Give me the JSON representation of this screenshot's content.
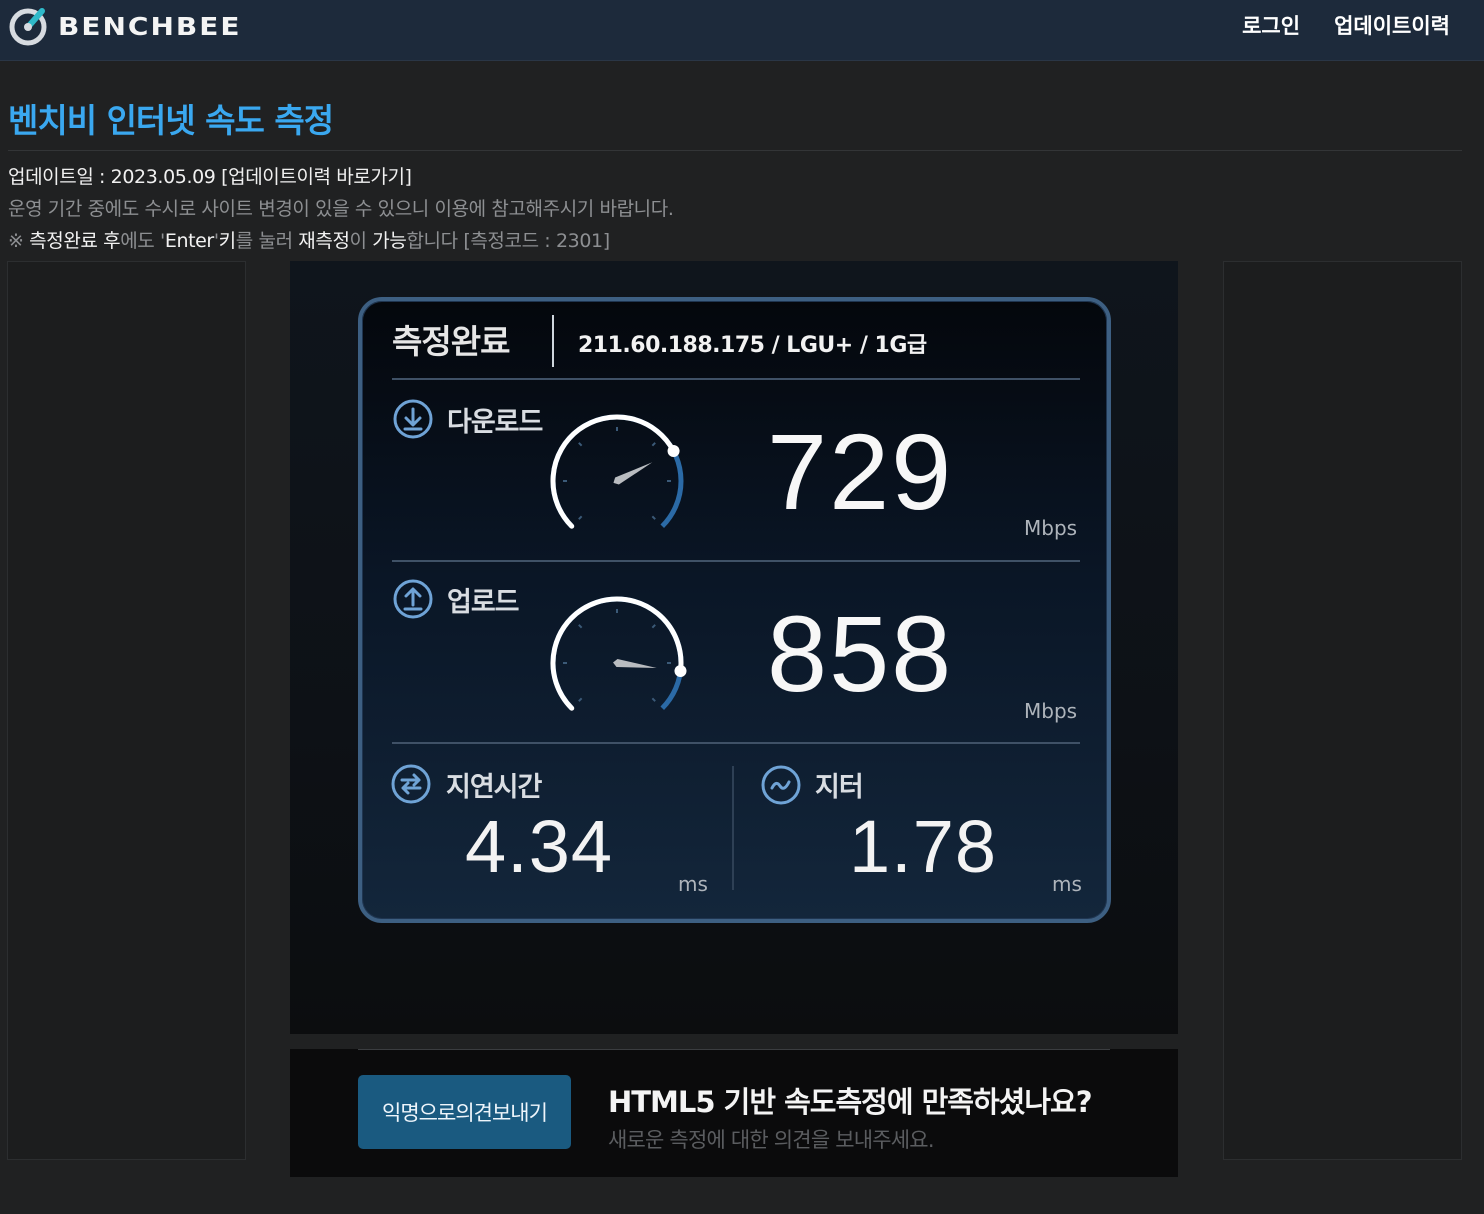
{
  "header": {
    "logo_text": "BENCHBEE",
    "nav": [
      "로그인",
      "업데이트이력"
    ]
  },
  "page": {
    "title": "벤치비 인터넷 속도 측정",
    "update_line_prefix": "업데이트일 : 2023.05.09 ",
    "update_link": "[업데이트이력 바로가기]",
    "notice": "운영 기간 중에도 수시로 사이트 변경이 있을 수 있으니 이용에 참고해주시기 바랍니다.",
    "tip": {
      "p1": "※ ",
      "p2": "측정완료 후",
      "p3": "에도 '",
      "p4": "Enter",
      "p5": "'",
      "p6": "키",
      "p7": "를 눌러 ",
      "p8": "재측정",
      "p9": "이 ",
      "p10": "가능",
      "p11": "합니다 [측정코드 : 2301]"
    }
  },
  "result": {
    "status": "측정완료",
    "connection": "211.60.188.175 / LGU+ / 1G급",
    "download": {
      "label": "다운로드",
      "value": "729",
      "unit": "Mbps",
      "gauge_fraction": 0.73
    },
    "upload": {
      "label": "업로드",
      "value": "858",
      "unit": "Mbps",
      "gauge_fraction": 0.86
    },
    "latency": {
      "label": "지연시간",
      "value": "4.34",
      "unit": "ms"
    },
    "jitter": {
      "label": "지터",
      "value": "1.78",
      "unit": "ms"
    }
  },
  "feedback": {
    "button": "익명으로의견보내기",
    "title": "HTML5 기반 속도측정에 만족하셨나요?",
    "subtitle": "새로운 측정에 대한 의견을 보내주세요."
  },
  "colors": {
    "accent": "#3aa8f0",
    "topbar": "#1d2a3b",
    "card_border": "#3d5f82",
    "button": "#1a5a80"
  },
  "icons": [
    "benchbee-logo-icon",
    "download-icon",
    "upload-icon",
    "latency-swap-icon",
    "jitter-wave-icon"
  ]
}
